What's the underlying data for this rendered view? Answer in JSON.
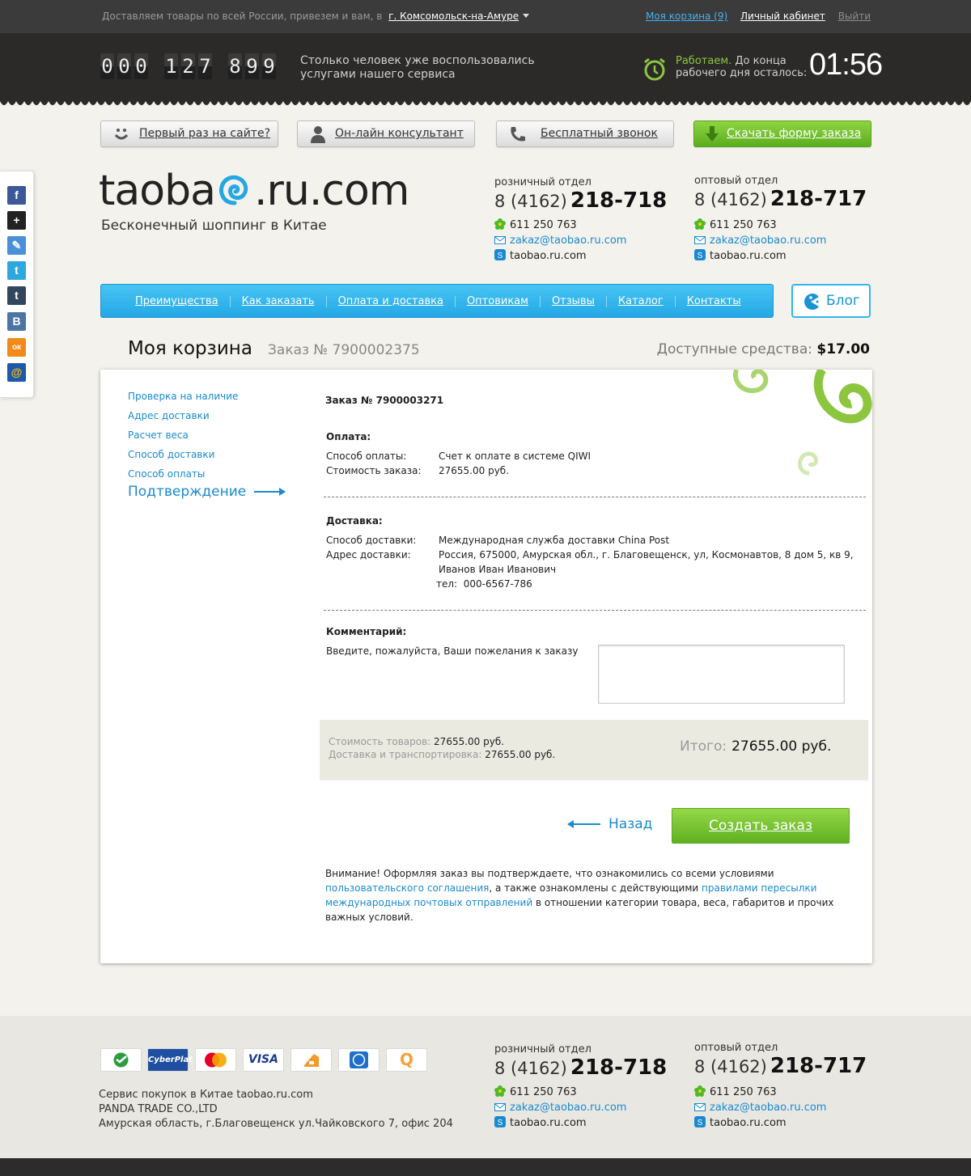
{
  "topbar": {
    "delivery_text": "Доставляем товары по всей России, привезем и вам, в",
    "city": "г. Комсомольск-на-Амуре",
    "cart_link": "Моя корзина (9)",
    "cabinet_link": "Личный кабинет",
    "exit_link": "Выйти"
  },
  "counter": {
    "digits": [
      "0",
      "0",
      "0",
      "1",
      "2",
      "7",
      "8",
      "9",
      "9"
    ],
    "text": "Столько человек уже воспользовались услугами нашего сервиса"
  },
  "work": {
    "status": "Работаем.",
    "text1": " До конца",
    "text2": "рабочего дня осталось:",
    "timer": "01:56"
  },
  "quick_buttons": [
    {
      "label": "Первый раз на сайте?",
      "icon": "smiley-icon"
    },
    {
      "label": "Он-лайн консультант",
      "icon": "person-icon"
    },
    {
      "label": "Бесплатный звонок",
      "icon": "phone-icon"
    },
    {
      "label": "Скачать форму заказа",
      "icon": "download-arrow-icon"
    }
  ],
  "logo": {
    "part1": "taoba",
    "part2": ".ru.com",
    "slogan": "Бесконечный шоппинг в Китае"
  },
  "contacts": {
    "retail": {
      "dept": "розничный отдел",
      "code": "8 (4162)",
      "number": "218-718",
      "icq": "611 250 763",
      "email": "zakaz@taobao.ru.com",
      "skype": "taobao.ru.com"
    },
    "wholesale": {
      "dept": "оптовый отдел",
      "code": "8 (4162)",
      "number": "218-717",
      "icq": "611 250 763",
      "email": "zakaz@taobao.ru.com",
      "skype": "taobao.ru.com"
    }
  },
  "social": [
    "f",
    "+",
    "✎",
    "t",
    "t",
    "В",
    "ок",
    "@"
  ],
  "nav": {
    "items": [
      "Преимущества",
      "Как заказать",
      "Оплата и доставка",
      "Оптовикам",
      "Отзывы",
      "Каталог",
      "Контакты"
    ],
    "blog": "Блог"
  },
  "heading": {
    "title": "Моя корзина",
    "order": "Заказ № 7900002375",
    "funds_label": "Доступные средства:",
    "funds_value": "$17.00"
  },
  "steps": [
    "Проверка на наличие",
    "Адрес доставки",
    "Расчет веса",
    "Способ доставки",
    "Способ оплаты"
  ],
  "active_step": "Подтверждение",
  "order": {
    "title": "Заказ № 7900003271",
    "payment": {
      "heading": "Оплата:",
      "method_label": "Способ оплаты:",
      "method_value": "Счет к оплате в системе QIWI",
      "cost_label": "Стоимость заказа:",
      "cost_value": "27655.00 руб."
    },
    "delivery": {
      "heading": "Доставка:",
      "method_label": "Способ доставки:",
      "method_value": "Международная служба доставки China Post",
      "address_label": "Адрес доставки:",
      "address_line1": "Россия, 675000, Амурская обл., г. Благовещенск, ул, Космонавтов, 8 дом 5, кв 9,",
      "address_line2": "Иванов Иван Иванович",
      "phone_label": "тел:",
      "phone_value": "000-6567-786"
    },
    "comment": {
      "heading": "Комментарий:",
      "prompt": "Введите, пожалуйста, Ваши пожелания к заказу",
      "value": ""
    },
    "summary": {
      "goods_label": "Стоимость товаров:",
      "goods_value": "27655.00 руб.",
      "delivery_label": "Доставка и транспортировка:",
      "delivery_value": "27655.00 руб.",
      "total_label": "Итого:",
      "total_value": "27655.00 руб."
    },
    "back": "Назад",
    "create": "Создать заказ"
  },
  "note": {
    "text1": "Внимание! Оформляя заказ вы подтверждаете, что ознакомились со всеми условиями",
    "link1": "пользовательского соглашения",
    "text2": ", а также ознакомлены с действующими",
    "link2": "правилами пересылки международных почтовых отправлений",
    "text3": " в отношении категории товара, веса, габаритов и прочих важных условий."
  },
  "payments": [
    {
      "name": "sberbank",
      "label": "",
      "color": "#2e9b3f"
    },
    {
      "name": "cyberplat",
      "label": "CyberPlat",
      "color": "#1e4fa0"
    },
    {
      "name": "mastercard",
      "label": "",
      "color": "#e8a020"
    },
    {
      "name": "visa",
      "label": "VISA",
      "color": "#1a3a8c"
    },
    {
      "name": "yandex-money",
      "label": "",
      "color": "#f29a2e"
    },
    {
      "name": "webmoney",
      "label": "",
      "color": "#1f6fc9"
    },
    {
      "name": "qiwi",
      "label": "Q",
      "color": "#f6a13a"
    }
  ],
  "footer": {
    "line1": "Сервис покупок в Китае taobao.ru.com",
    "line2": "PANDA TRADE CO.,LTD",
    "line3": "Амурская область, г.Благовещенск ул.Чайковского 7, офис 204"
  }
}
